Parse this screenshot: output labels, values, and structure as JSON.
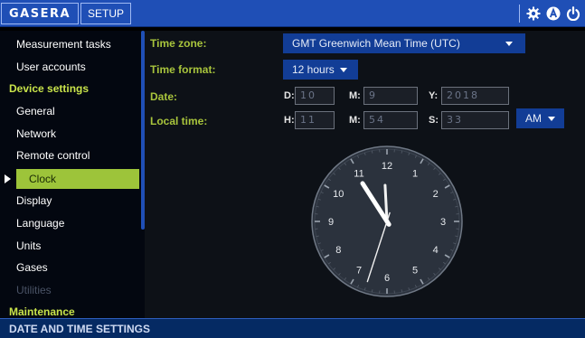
{
  "header": {
    "brand": "GASERA",
    "tab_label": "SETUP",
    "icons": [
      "gear-icon",
      "auto-mode-icon",
      "power-icon"
    ]
  },
  "sidebar": {
    "items": [
      {
        "label": "Measurement tasks",
        "type": "item"
      },
      {
        "label": "User accounts",
        "type": "item"
      },
      {
        "label": "Device settings",
        "type": "header"
      },
      {
        "label": "General",
        "type": "item"
      },
      {
        "label": "Network",
        "type": "item"
      },
      {
        "label": "Remote control",
        "type": "item"
      },
      {
        "label": "Clock",
        "type": "active"
      },
      {
        "label": "Display",
        "type": "item"
      },
      {
        "label": "Language",
        "type": "item"
      },
      {
        "label": "Units",
        "type": "item"
      },
      {
        "label": "Gases",
        "type": "item"
      },
      {
        "label": "Utilities",
        "type": "disabled"
      },
      {
        "label": "Maintenance",
        "type": "header"
      }
    ]
  },
  "form": {
    "time_zone": {
      "label": "Time zone:",
      "value": "GMT Greenwich Mean Time (UTC)"
    },
    "time_format": {
      "label": "Time format:",
      "value": "12 hours"
    },
    "date": {
      "label": "Date:",
      "day_prefix": "D:",
      "day": "10",
      "month_prefix": "M:",
      "month": "9",
      "year_prefix": "Y:",
      "year": "2018"
    },
    "local_time": {
      "label": "Local time:",
      "hour_prefix": "H:",
      "hour": "11",
      "minute_prefix": "M:",
      "minute": "54",
      "second_prefix": "S:",
      "second": "33",
      "ampm": "AM"
    }
  },
  "clock": {
    "numerals": [
      "12",
      "1",
      "2",
      "3",
      "4",
      "5",
      "6",
      "7",
      "8",
      "9",
      "10",
      "11"
    ],
    "hour": 11,
    "minute": 54,
    "second": 33
  },
  "footer": {
    "title": "DATE AND TIME SETTINGS"
  },
  "colors": {
    "topbar": "#1f4fb6",
    "accent_green": "#9dc43a",
    "label_green": "#a8c43c",
    "dropdown_blue": "#123d96"
  }
}
